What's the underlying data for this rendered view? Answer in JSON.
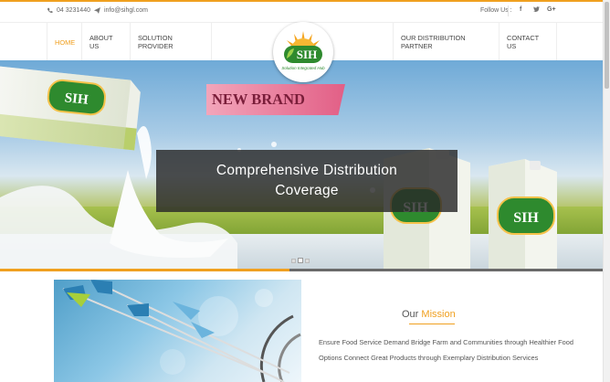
{
  "topbar": {
    "phone": "04 3231440",
    "email": "info@sihgl.com",
    "follow_label": "Follow Us :",
    "social": [
      "f",
      "y",
      "G+"
    ]
  },
  "nav": {
    "left": [
      "HOME",
      "ABOUT US",
      "SOLUTION PROVIDER"
    ],
    "right": [
      "OUR DISTRIBUTION PARTNER",
      "CONTACT US"
    ]
  },
  "logo": {
    "text": "SIH",
    "tagline": "Solution Integrated Hub"
  },
  "hero": {
    "ribbon": "NEW BRAND",
    "caption_line1": "Comprehensive Distribution",
    "caption_line2": "Coverage",
    "carton_brand": "SIH",
    "active_slide": 2,
    "slide_count": 3,
    "progress_fraction": 0.48
  },
  "mission": {
    "title_part1": "Our",
    "title_part2": "Mission",
    "text": "Ensure Food Service Demand Bridge Farm and Communities through Healthier Food Options Connect Great Products through Exemplary Distribution Services"
  },
  "colors": {
    "accent": "#f0a020",
    "brand_green": "#2e8a2e"
  }
}
